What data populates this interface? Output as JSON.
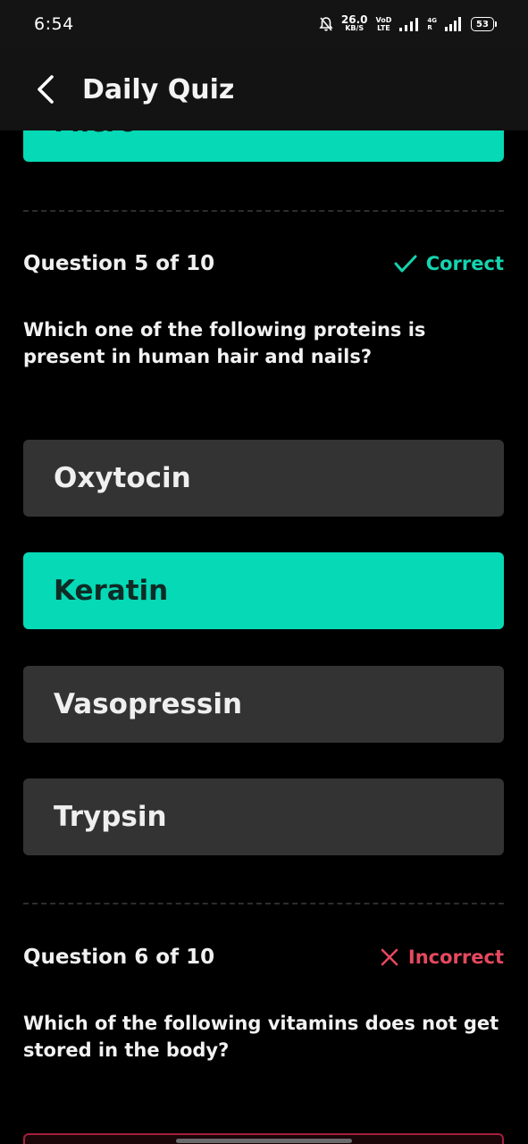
{
  "status_bar": {
    "time": "6:54",
    "net_speed": "26.0",
    "net_unit": "KB/S",
    "vo_top": "VoD",
    "vo_bottom": "LTE",
    "network_4g_top": "4G",
    "network_4g_bottom": "R",
    "battery": "53"
  },
  "app_bar": {
    "title": "Daily Quiz",
    "back_icon": "chevron-left-icon"
  },
  "previous_option": {
    "label": "Micro"
  },
  "questions": [
    {
      "number_label": "Question 5 of 10",
      "status": "Correct",
      "status_icon": "checkmark-icon",
      "status_color": "#14d4b0",
      "text": "Which one of the following proteins is present in human hair and nails?",
      "options": [
        {
          "label": "Oxytocin",
          "selected": false
        },
        {
          "label": "Keratin",
          "selected": true
        },
        {
          "label": "Vasopressin",
          "selected": false
        },
        {
          "label": "Trypsin",
          "selected": false
        }
      ]
    },
    {
      "number_label": "Question 6 of 10",
      "status": "Incorrect",
      "status_icon": "cross-icon",
      "status_color": "#e5495f",
      "text": "Which of the following vitamins does not get stored in the body?"
    }
  ],
  "colors": {
    "accent": "#05d9b5",
    "option_bg": "#333333",
    "background": "#000000"
  }
}
